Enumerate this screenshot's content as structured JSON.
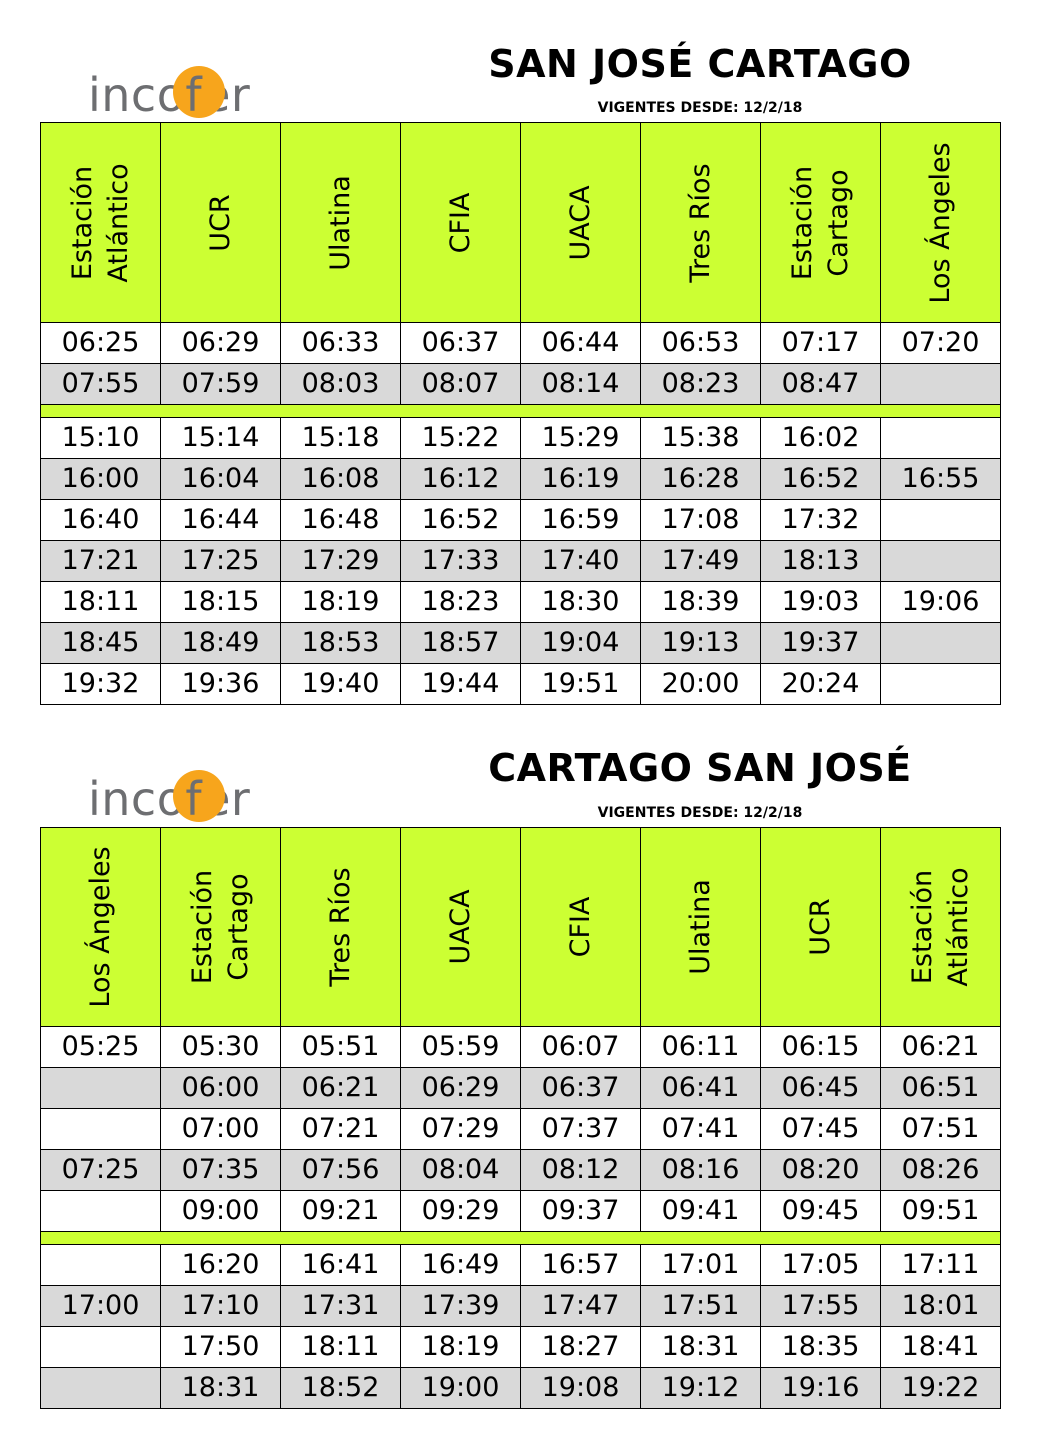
{
  "logo": {
    "pre": "inco",
    "f": "f",
    "post": "er"
  },
  "tables": [
    {
      "title": "SAN JOSÉ CARTAGO",
      "subtitle": "VIGENTES DESDE: 12/2/18",
      "headers": [
        "Estación\nAtlántico",
        "UCR",
        "Ulatina",
        "CFIA",
        "UACA",
        "Tres Ríos",
        "Estación\nCartago",
        "Los Ángeles"
      ],
      "blocks": [
        [
          [
            "06:25",
            "06:29",
            "06:33",
            "06:37",
            "06:44",
            "06:53",
            "07:17",
            "07:20"
          ],
          [
            "07:55",
            "07:59",
            "08:03",
            "08:07",
            "08:14",
            "08:23",
            "08:47",
            ""
          ]
        ],
        [
          [
            "15:10",
            "15:14",
            "15:18",
            "15:22",
            "15:29",
            "15:38",
            "16:02",
            ""
          ],
          [
            "16:00",
            "16:04",
            "16:08",
            "16:12",
            "16:19",
            "16:28",
            "16:52",
            "16:55"
          ],
          [
            "16:40",
            "16:44",
            "16:48",
            "16:52",
            "16:59",
            "17:08",
            "17:32",
            ""
          ],
          [
            "17:21",
            "17:25",
            "17:29",
            "17:33",
            "17:40",
            "17:49",
            "18:13",
            ""
          ],
          [
            "18:11",
            "18:15",
            "18:19",
            "18:23",
            "18:30",
            "18:39",
            "19:03",
            "19:06"
          ],
          [
            "18:45",
            "18:49",
            "18:53",
            "18:57",
            "19:04",
            "19:13",
            "19:37",
            ""
          ],
          [
            "19:32",
            "19:36",
            "19:40",
            "19:44",
            "19:51",
            "20:00",
            "20:24",
            ""
          ]
        ]
      ]
    },
    {
      "title": "CARTAGO SAN JOSÉ",
      "subtitle": "VIGENTES DESDE: 12/2/18",
      "headers": [
        "Los Ángeles",
        "Estación\nCartago",
        "Tres Ríos",
        "UACA",
        "CFIA",
        "Ulatina",
        "UCR",
        "Estación\nAtlántico"
      ],
      "blocks": [
        [
          [
            "05:25",
            "05:30",
            "05:51",
            "05:59",
            "06:07",
            "06:11",
            "06:15",
            "06:21"
          ],
          [
            "",
            "06:00",
            "06:21",
            "06:29",
            "06:37",
            "06:41",
            "06:45",
            "06:51"
          ],
          [
            "",
            "07:00",
            "07:21",
            "07:29",
            "07:37",
            "07:41",
            "07:45",
            "07:51"
          ],
          [
            "07:25",
            "07:35",
            "07:56",
            "08:04",
            "08:12",
            "08:16",
            "08:20",
            "08:26"
          ],
          [
            "",
            "09:00",
            "09:21",
            "09:29",
            "09:37",
            "09:41",
            "09:45",
            "09:51"
          ]
        ],
        [
          [
            "",
            "16:20",
            "16:41",
            "16:49",
            "16:57",
            "17:01",
            "17:05",
            "17:11"
          ],
          [
            "17:00",
            "17:10",
            "17:31",
            "17:39",
            "17:47",
            "17:51",
            "17:55",
            "18:01"
          ],
          [
            "",
            "17:50",
            "18:11",
            "18:19",
            "18:27",
            "18:31",
            "18:35",
            "18:41"
          ],
          [
            "",
            "18:31",
            "18:52",
            "19:00",
            "19:08",
            "19:12",
            "19:16",
            "19:22"
          ]
        ]
      ]
    }
  ],
  "colors": {
    "header_bg": "#ccff33",
    "shade_row": "#d9d9d9",
    "logo_circle": "#f7a51c",
    "logo_text": "#6d6e71"
  }
}
